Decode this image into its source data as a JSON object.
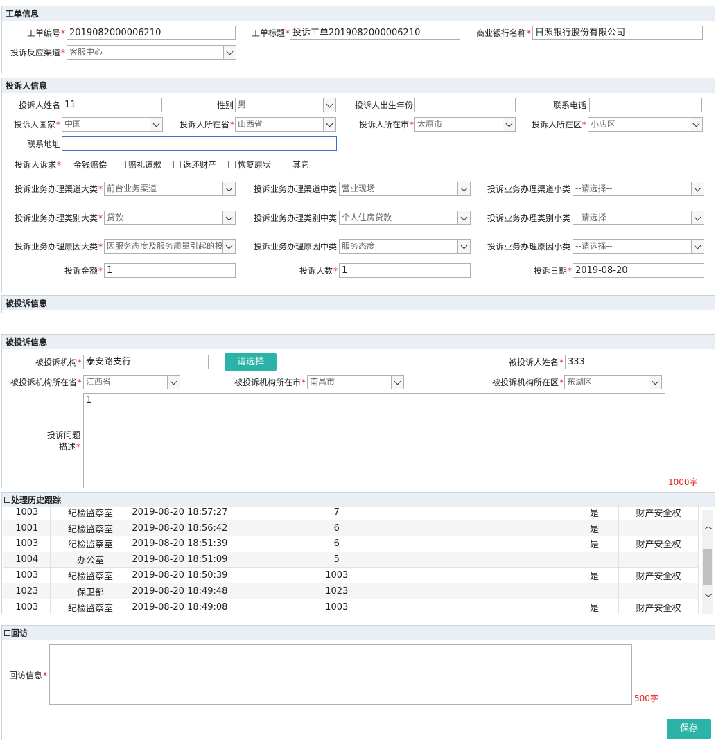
{
  "ticket": {
    "header": "工单信息",
    "no_label": "工单编号",
    "no_value": "2019082000006210",
    "title_label": "工单标题",
    "title_value": "投诉工单2019082000006210",
    "bank_label": "商业银行名称",
    "bank_value": "日照银行股份有限公司",
    "channel_label": "投诉反应渠道",
    "channel_value": "客服中心"
  },
  "complainant": {
    "header": "投诉人信息",
    "name_label": "投诉人姓名",
    "name_value": "11",
    "gender_label": "性别",
    "gender_value": "男",
    "birth_label": "投诉人出生年份",
    "birth_value": "",
    "phone_label": "联系电话",
    "phone_value": "",
    "country_label": "投诉人国家",
    "country_value": "中国",
    "province_label": "投诉人所在省",
    "province_value": "山西省",
    "city_label": "投诉人所在市",
    "city_value": "太原市",
    "district_label": "投诉人所在区",
    "district_value": "小店区",
    "address_label": "联系地址",
    "address_value": "",
    "demand_label": "投诉人诉求",
    "demands": [
      "金钱赔偿",
      "赔礼道歉",
      "返还财产",
      "恢复原状",
      "其它"
    ],
    "ch_big_label": "投诉业务办理渠道大类",
    "ch_big_value": "前台业务渠道",
    "ch_mid_label": "投诉业务办理渠道中类",
    "ch_mid_value": "营业现场",
    "ch_small_label": "投诉业务办理渠道小类",
    "ch_small_value": "--请选择--",
    "cat_big_label": "投诉业务办理类别大类",
    "cat_big_value": "贷款",
    "cat_mid_label": "投诉业务办理类别中类",
    "cat_mid_value": "个人住房贷款",
    "cat_small_label": "投诉业务办理类别小类",
    "cat_small_value": "--请选择--",
    "rsn_big_label": "投诉业务办理原因大类",
    "rsn_big_value": "因服务态度及服务质量引起的投",
    "rsn_mid_label": "投诉业务办理原因中类",
    "rsn_mid_value": "服务态度",
    "rsn_small_label": "投诉业务办理原因小类",
    "rsn_small_value": "--请选择--",
    "amount_label": "投诉金额",
    "amount_value": "1",
    "count_label": "投诉人数",
    "count_value": "1",
    "date_label": "投诉日期",
    "date_value": "2019-08-20"
  },
  "respondent_collapsed": {
    "header": "被投诉信息"
  },
  "respondent": {
    "header": "被投诉信息",
    "org_label": "被投诉机构",
    "org_value": "泰安路支行",
    "choose_button": "请选择",
    "person_label": "被投诉人姓名",
    "person_value": "333",
    "province_label": "被投诉机构所在省",
    "province_value": "江西省",
    "city_label": "被投诉机构所在市",
    "city_value": "南昌市",
    "district_label": "被投诉机构所在区",
    "district_value": "东湖区",
    "desc_label_1": "投诉问题",
    "desc_label_2": "描述",
    "desc_value": "1",
    "desc_limit": "1000字"
  },
  "history": {
    "header": "处理历史跟踪",
    "rows": [
      [
        "1003",
        "纪检监察室",
        "2019-08-20 18:57:27",
        "7",
        "",
        "",
        "是",
        "财产安全权"
      ],
      [
        "1001",
        "纪检监察室",
        "2019-08-20 18:56:42",
        "6",
        "",
        "",
        "是",
        ""
      ],
      [
        "1003",
        "纪检监察室",
        "2019-08-20 18:51:39",
        "6",
        "",
        "",
        "是",
        "财产安全权"
      ],
      [
        "1004",
        "办公室",
        "2019-08-20 18:51:09",
        "5",
        "",
        "",
        "",
        ""
      ],
      [
        "1003",
        "纪检监察室",
        "2019-08-20 18:50:39",
        "1003",
        "",
        "",
        "是",
        "财产安全权"
      ],
      [
        "1023",
        "保卫部",
        "2019-08-20 18:49:48",
        "1023",
        "",
        "",
        "",
        ""
      ],
      [
        "1003",
        "纪检监察室",
        "2019-08-20 18:49:08",
        "1003",
        "",
        "",
        "是",
        "财产安全权"
      ]
    ]
  },
  "revisit": {
    "header": "回访",
    "info_label": "回访信息",
    "info_value": "",
    "limit": "500字",
    "save_button": "保存"
  },
  "colors": {
    "accent": "#2bb3a7",
    "required": "#e02020",
    "header_bg": "#e9eff4"
  }
}
